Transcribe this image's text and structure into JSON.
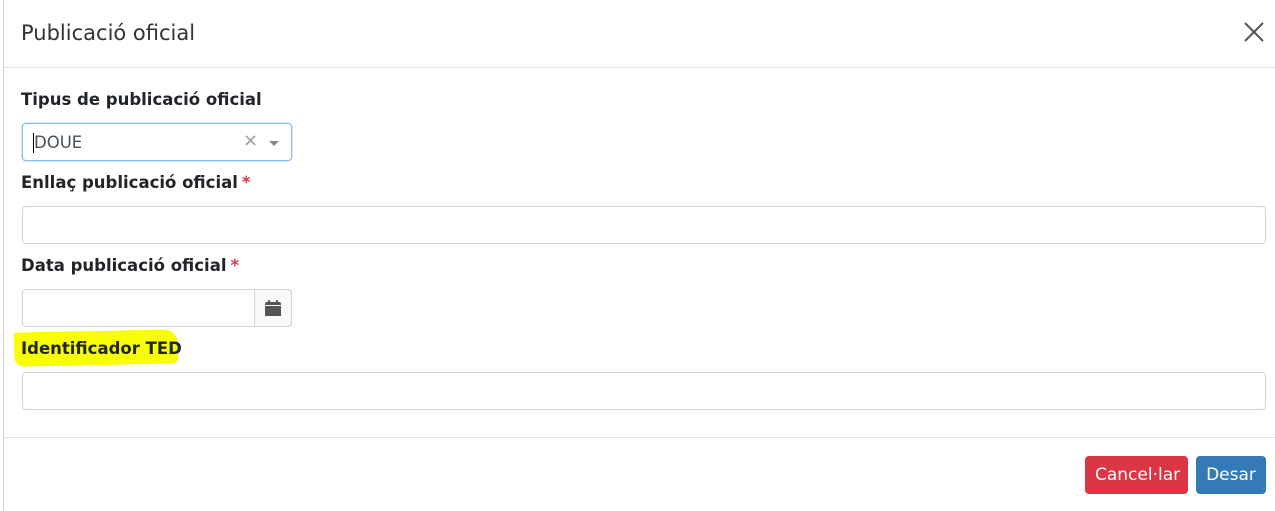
{
  "modal": {
    "title": "Publicació oficial",
    "close_icon": "close-icon"
  },
  "form": {
    "publication_type": {
      "label": "Tipus de publicació oficial",
      "value": "DOUE",
      "clear_symbol": "×"
    },
    "link": {
      "label": "Enllaç publicació oficial",
      "required_mark": "*",
      "value": ""
    },
    "date": {
      "label": "Data publicació oficial",
      "required_mark": "*",
      "value": "",
      "calendar_icon": "calendar-icon"
    },
    "ted_id": {
      "label": "Identificador TED",
      "value": "",
      "highlight_color": "#f7ff00"
    }
  },
  "footer": {
    "cancel_label": "Cancel·lar",
    "save_label": "Desar"
  },
  "colors": {
    "cancel": "#dc3545",
    "save": "#337ab7",
    "required": "#dc3545"
  }
}
